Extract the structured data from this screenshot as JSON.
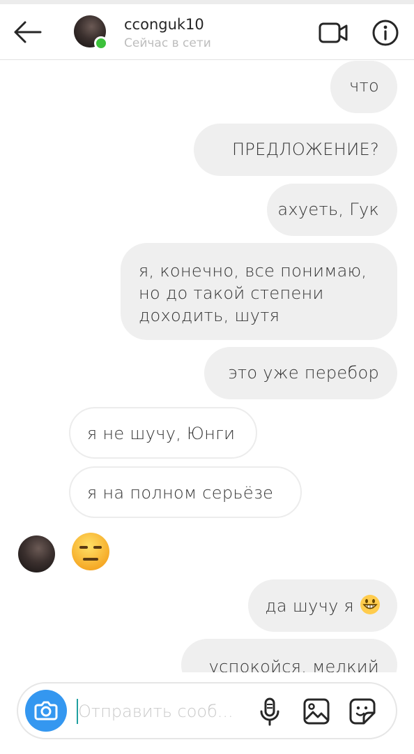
{
  "header": {
    "username": "cconguk10",
    "status": "Сейчас в сети",
    "back_icon": "arrow-left-icon",
    "video_icon": "video-camera-icon",
    "info_icon": "info-icon"
  },
  "messages": [
    {
      "direction": "outgoing",
      "text": "что"
    },
    {
      "direction": "outgoing",
      "text": "ПРЕДЛОЖЕНИЕ?"
    },
    {
      "direction": "outgoing",
      "text": "ахуеть, Гук"
    },
    {
      "direction": "outgoing",
      "lines": [
        "я, конечно, все понимаю,",
        "но до такой степени",
        "доходить, шутя"
      ]
    },
    {
      "direction": "outgoing",
      "text": "это уже перебор"
    },
    {
      "direction": "incoming",
      "text": "я не шучу, Юнги"
    },
    {
      "direction": "incoming",
      "text": "я на полном серьёзе"
    },
    {
      "direction": "incoming",
      "emoji": "expressionless-face"
    },
    {
      "direction": "outgoing",
      "text": "да шучу я",
      "emoji": "grinning-face"
    },
    {
      "direction": "outgoing",
      "text": "успокойся, мелкий"
    }
  ],
  "composer": {
    "placeholder": "Отправить сооб...",
    "value": "",
    "camera_icon": "camera-icon",
    "mic_icon": "microphone-icon",
    "gallery_icon": "gallery-icon",
    "sticker_icon": "sticker-icon"
  },
  "colors": {
    "accent": "#3497f0",
    "online": "#3cc13b",
    "outgoing_bubble": "#efefef",
    "incoming_border": "#ececec"
  }
}
